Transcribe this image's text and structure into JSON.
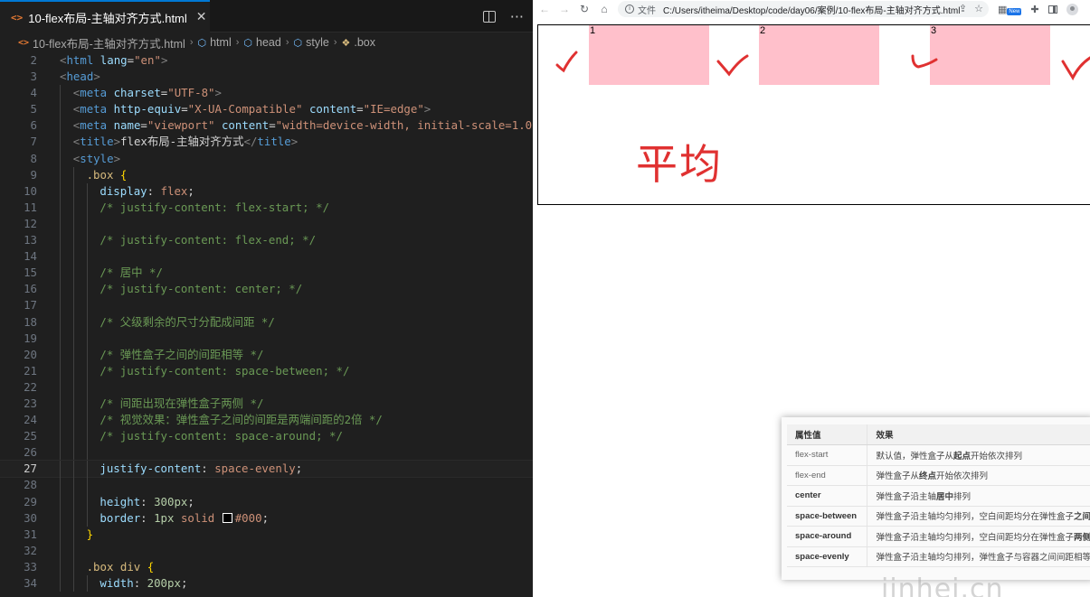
{
  "editor": {
    "tab": {
      "icon": "<>",
      "label": "10-flex布局-主轴对齐方式.html",
      "close": "✕"
    },
    "actions": {
      "split_icon": "split-editor-icon",
      "more_label": "···"
    },
    "breadcrumb": [
      {
        "label": "10-flex布局-主轴对齐方式.html",
        "icon": "html-file-icon",
        "glyph": "<>"
      },
      {
        "label": "html",
        "icon": "element-cube-icon",
        "glyph": "⬡"
      },
      {
        "label": "head",
        "icon": "element-cube-icon",
        "glyph": "⬡"
      },
      {
        "label": "style",
        "icon": "element-cube-icon",
        "glyph": "⬡"
      },
      {
        "label": ".box",
        "icon": "css-class-icon",
        "glyph": "❖"
      }
    ],
    "breadcrumb_separator": "›",
    "current_line": "27",
    "lines": [
      {
        "n": "2",
        "indent": 0,
        "tokens": [
          [
            "t-pun",
            "<"
          ],
          [
            "t-tag",
            "html"
          ],
          [
            "t-plain",
            " "
          ],
          [
            "t-attr",
            "lang"
          ],
          [
            "t-plain",
            "="
          ],
          [
            "t-str",
            "\"en\""
          ],
          [
            "t-pun",
            ">"
          ]
        ]
      },
      {
        "n": "3",
        "indent": 0,
        "tokens": [
          [
            "t-pun",
            "<"
          ],
          [
            "t-tag",
            "head"
          ],
          [
            "t-pun",
            ">"
          ]
        ]
      },
      {
        "n": "4",
        "indent": 1,
        "tokens": [
          [
            "t-pun",
            "<"
          ],
          [
            "t-tag",
            "meta"
          ],
          [
            "t-plain",
            " "
          ],
          [
            "t-attr",
            "charset"
          ],
          [
            "t-plain",
            "="
          ],
          [
            "t-str",
            "\"UTF-8\""
          ],
          [
            "t-pun",
            ">"
          ]
        ]
      },
      {
        "n": "5",
        "indent": 1,
        "tokens": [
          [
            "t-pun",
            "<"
          ],
          [
            "t-tag",
            "meta"
          ],
          [
            "t-plain",
            " "
          ],
          [
            "t-attr",
            "http-equiv"
          ],
          [
            "t-plain",
            "="
          ],
          [
            "t-str",
            "\"X-UA-Compatible\""
          ],
          [
            "t-plain",
            " "
          ],
          [
            "t-attr",
            "content"
          ],
          [
            "t-plain",
            "="
          ],
          [
            "t-str",
            "\"IE=edge\""
          ],
          [
            "t-pun",
            ">"
          ]
        ]
      },
      {
        "n": "6",
        "indent": 1,
        "tokens": [
          [
            "t-pun",
            "<"
          ],
          [
            "t-tag",
            "meta"
          ],
          [
            "t-plain",
            " "
          ],
          [
            "t-attr",
            "name"
          ],
          [
            "t-plain",
            "="
          ],
          [
            "t-str",
            "\"viewport\""
          ],
          [
            "t-plain",
            " "
          ],
          [
            "t-attr",
            "content"
          ],
          [
            "t-plain",
            "="
          ],
          [
            "t-str",
            "\"width=device-width, initial-scale=1.0\""
          ],
          [
            "t-pun",
            ">"
          ]
        ]
      },
      {
        "n": "7",
        "indent": 1,
        "tokens": [
          [
            "t-pun",
            "<"
          ],
          [
            "t-tag",
            "title"
          ],
          [
            "t-pun",
            ">"
          ],
          [
            "t-plain",
            "flex布局-主轴对齐方式"
          ],
          [
            "t-pun",
            "</"
          ],
          [
            "t-tag",
            "title"
          ],
          [
            "t-pun",
            ">"
          ]
        ]
      },
      {
        "n": "8",
        "indent": 1,
        "tokens": [
          [
            "t-pun",
            "<"
          ],
          [
            "t-tag",
            "style"
          ],
          [
            "t-pun",
            ">"
          ]
        ]
      },
      {
        "n": "9",
        "indent": 2,
        "tokens": [
          [
            "t-sel",
            ".box"
          ],
          [
            "t-plain",
            " "
          ],
          [
            "t-brace",
            "{"
          ]
        ]
      },
      {
        "n": "10",
        "indent": 3,
        "tokens": [
          [
            "t-prop",
            "display"
          ],
          [
            "t-plain",
            ": "
          ],
          [
            "t-val",
            "flex"
          ],
          [
            "t-plain",
            ";"
          ]
        ]
      },
      {
        "n": "11",
        "indent": 3,
        "tokens": [
          [
            "t-com",
            "/* justify-content: flex-start; */"
          ]
        ]
      },
      {
        "n": "12",
        "indent": 3,
        "tokens": []
      },
      {
        "n": "13",
        "indent": 3,
        "tokens": [
          [
            "t-com",
            "/* justify-content: flex-end; */"
          ]
        ]
      },
      {
        "n": "14",
        "indent": 3,
        "tokens": []
      },
      {
        "n": "15",
        "indent": 3,
        "tokens": [
          [
            "t-com",
            "/* 居中 */"
          ]
        ]
      },
      {
        "n": "16",
        "indent": 3,
        "tokens": [
          [
            "t-com",
            "/* justify-content: center; */"
          ]
        ]
      },
      {
        "n": "17",
        "indent": 3,
        "tokens": []
      },
      {
        "n": "18",
        "indent": 3,
        "tokens": [
          [
            "t-com",
            "/* 父级剩余的尺寸分配成间距 */"
          ]
        ]
      },
      {
        "n": "19",
        "indent": 3,
        "tokens": []
      },
      {
        "n": "20",
        "indent": 3,
        "tokens": [
          [
            "t-com",
            "/* 弹性盒子之间的间距相等 */"
          ]
        ]
      },
      {
        "n": "21",
        "indent": 3,
        "tokens": [
          [
            "t-com",
            "/* justify-content: space-between; */"
          ]
        ]
      },
      {
        "n": "22",
        "indent": 3,
        "tokens": []
      },
      {
        "n": "23",
        "indent": 3,
        "tokens": [
          [
            "t-com",
            "/* 间距出现在弹性盒子两侧 */"
          ]
        ]
      },
      {
        "n": "24",
        "indent": 3,
        "tokens": [
          [
            "t-com",
            "/* 视觉效果：弹性盒子之间的间距是两端间距的2倍 */"
          ]
        ]
      },
      {
        "n": "25",
        "indent": 3,
        "tokens": [
          [
            "t-com",
            "/* justify-content: space-around; */"
          ]
        ]
      },
      {
        "n": "26",
        "indent": 3,
        "tokens": []
      },
      {
        "n": "27",
        "indent": 3,
        "tokens": [
          [
            "t-prop",
            "justify-content"
          ],
          [
            "t-plain",
            ": "
          ],
          [
            "t-val",
            "space-evenly"
          ],
          [
            "t-plain",
            ";"
          ]
        ]
      },
      {
        "n": "28",
        "indent": 3,
        "tokens": []
      },
      {
        "n": "29",
        "indent": 3,
        "tokens": [
          [
            "t-prop",
            "height"
          ],
          [
            "t-plain",
            ": "
          ],
          [
            "t-num",
            "300px"
          ],
          [
            "t-plain",
            ";"
          ]
        ]
      },
      {
        "n": "30",
        "indent": 3,
        "tokens": [
          [
            "t-prop",
            "border"
          ],
          [
            "t-plain",
            ": "
          ],
          [
            "t-num",
            "1px"
          ],
          [
            "t-plain",
            " "
          ],
          [
            "t-val",
            "solid"
          ],
          [
            "t-plain",
            " "
          ],
          [
            "swatch",
            ""
          ],
          [
            "t-val",
            "#000"
          ],
          [
            "t-plain",
            ";"
          ]
        ]
      },
      {
        "n": "31",
        "indent": 2,
        "tokens": [
          [
            "t-brace",
            "}"
          ]
        ]
      },
      {
        "n": "32",
        "indent": 2,
        "tokens": []
      },
      {
        "n": "33",
        "indent": 2,
        "tokens": [
          [
            "t-sel",
            ".box div"
          ],
          [
            "t-plain",
            " "
          ],
          [
            "t-brace",
            "{"
          ]
        ]
      },
      {
        "n": "34",
        "indent": 3,
        "tokens": [
          [
            "t-prop",
            "width"
          ],
          [
            "t-plain",
            ": "
          ],
          [
            "t-num",
            "200px"
          ],
          [
            "t-plain",
            ";"
          ]
        ]
      }
    ]
  },
  "browser": {
    "nav": {
      "back": "←",
      "forward": "→",
      "reload": "↻",
      "home": "⌂"
    },
    "address": {
      "file_label": "文件",
      "url": "C:/Users/itheima/Desktop/code/day06/案例/10-flex布局-主轴对齐方式.html",
      "share_icon": "share-icon",
      "bookmark_icon": "star-icon"
    },
    "extension_badge": "New",
    "flex_items": [
      "1",
      "2",
      "3"
    ],
    "annotation": "平均",
    "table": {
      "headers": [
        "属性值",
        "效果"
      ],
      "rows": [
        {
          "prop": "flex-start",
          "bold": false,
          "effect": [
            [
              "默认值，弹性盒子从",
              ""
            ],
            [
              "起点",
              "b"
            ],
            [
              "开始依次排列",
              ""
            ]
          ]
        },
        {
          "prop": "flex-end",
          "bold": false,
          "effect": [
            [
              "弹性盒子从",
              ""
            ],
            [
              "终点",
              "b"
            ],
            [
              "开始依次排列",
              ""
            ]
          ]
        },
        {
          "prop": "center",
          "bold": true,
          "effect": [
            [
              "弹性盒子沿主轴",
              ""
            ],
            [
              "居中",
              "b"
            ],
            [
              "排列",
              ""
            ]
          ]
        },
        {
          "prop": "space-between",
          "bold": true,
          "effect": [
            [
              "弹性盒子沿主轴均匀排列，空白间距均分在弹性盒子",
              ""
            ],
            [
              "之间",
              "b"
            ]
          ]
        },
        {
          "prop": "space-around",
          "bold": true,
          "effect": [
            [
              "弹性盒子沿主轴均匀排列，空白间距均分在弹性盒子",
              ""
            ],
            [
              "两侧",
              "b"
            ]
          ]
        },
        {
          "prop": "space-evenly",
          "bold": true,
          "effect": [
            [
              "弹性盒子沿主轴均匀排列，弹性盒子与容器之间间距相等",
              ""
            ]
          ]
        }
      ]
    },
    "watermark": "jinhei.cn"
  },
  "colors": {
    "editor_bg": "#1f1f1f",
    "accent": "#0078d4",
    "flex_item": "#ffc0cb",
    "annotation": "#e03131"
  }
}
